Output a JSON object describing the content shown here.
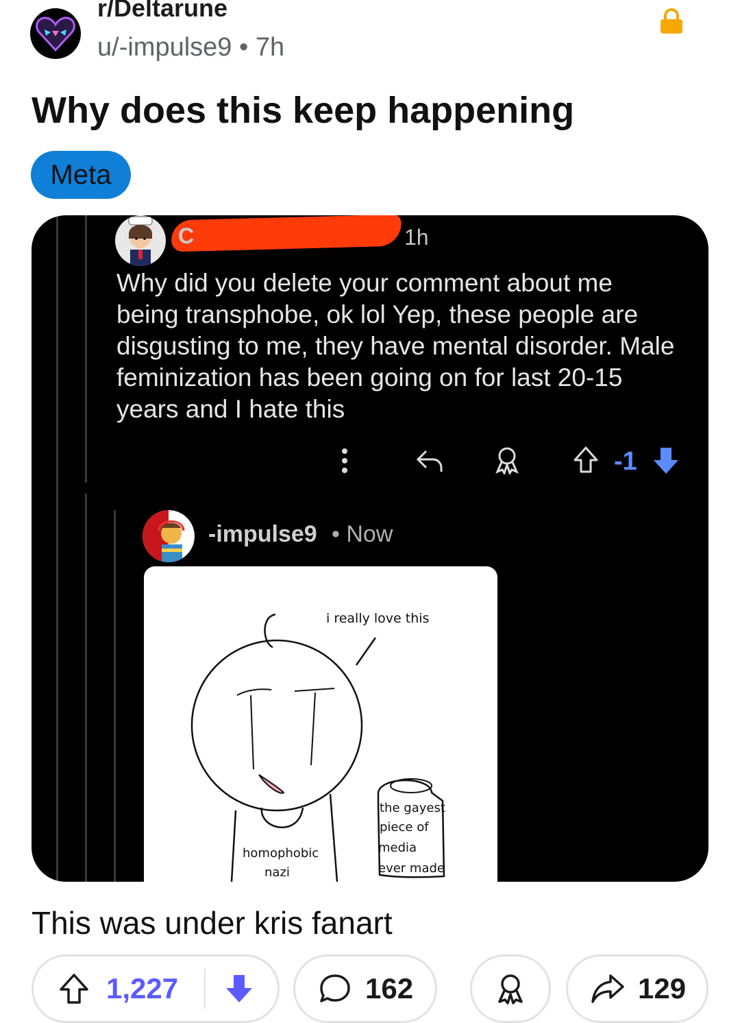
{
  "post": {
    "subreddit": "r/Deltarune",
    "byline": "u/-impulse9 • 7h",
    "title": "Why does this keep happening",
    "flair": "Meta",
    "body": "This was under kris fanart"
  },
  "screenshot": {
    "comment": {
      "username_partial": "C",
      "time": "1h",
      "text": "Why did you delete your comment about me being transphobe, ok lol Yep, these people are disgusting to me, they have mental disorder. Male feminization has been going on for last 20-15 years and I hate this",
      "score": "-1"
    },
    "reply": {
      "username": "-impulse9",
      "time": "• Now",
      "drawing": {
        "speech": "i really love this",
        "shirt_line1": "homophobic",
        "shirt_line2": "nazi",
        "sign_line1": "the gayest",
        "sign_line2": "piece of",
        "sign_line3": "media",
        "sign_line4": "ever made"
      }
    }
  },
  "actions": {
    "upvotes": "1,227",
    "comments": "162",
    "shares": "129"
  },
  "colors": {
    "flair_bg": "#0f7fd8",
    "lock": "#f6a800",
    "vote_accent": "#5b5bff",
    "comment_vote_accent": "#5b8cff",
    "redaction": "#ff3b0a"
  }
}
